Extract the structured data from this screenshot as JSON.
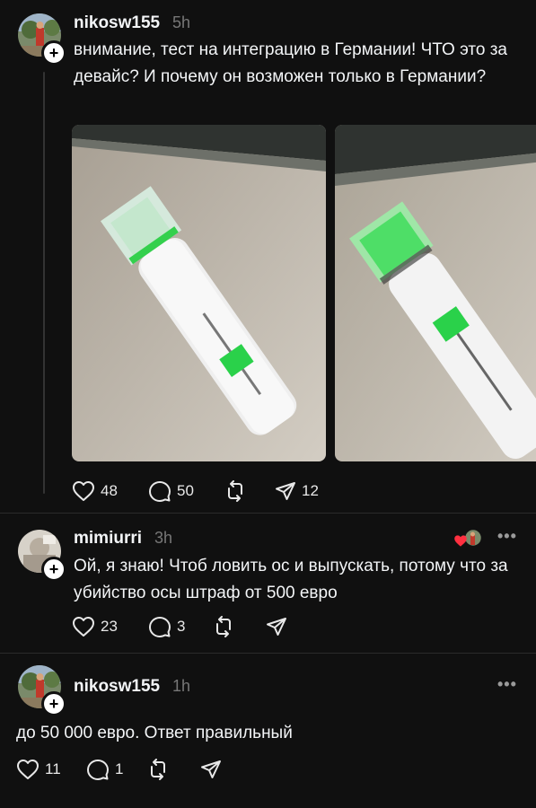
{
  "posts": [
    {
      "username": "nikosw155",
      "time": "5h",
      "text": "внимание, тест на интеграцию в Германии! ЧТО это за девайс? И почему он возможен только в Германии?",
      "stats": {
        "likes": "48",
        "comments": "50",
        "shares": "12"
      }
    },
    {
      "username": "mimiurri",
      "time": "3h",
      "more": "•••",
      "text": "Ой, я знаю! Чтоб ловить ос и выпускать, потому что за убийство осы штраф от 500 евро",
      "stats": {
        "likes": "23",
        "comments": "3"
      }
    },
    {
      "username": "nikosw155",
      "time": "1h",
      "more": "•••",
      "text": "до 50 000 евро. Ответ правильный",
      "stats": {
        "likes": "11",
        "comments": "1"
      }
    }
  ],
  "icons": {
    "like": "heart-icon",
    "comment": "comment-icon",
    "repost": "repost-icon",
    "share": "send-icon",
    "liked_badge": "red-heart-icon"
  },
  "colors": {
    "background": "#101010",
    "accent_green": "#2ad14a",
    "liked_red": "#ff3040"
  }
}
